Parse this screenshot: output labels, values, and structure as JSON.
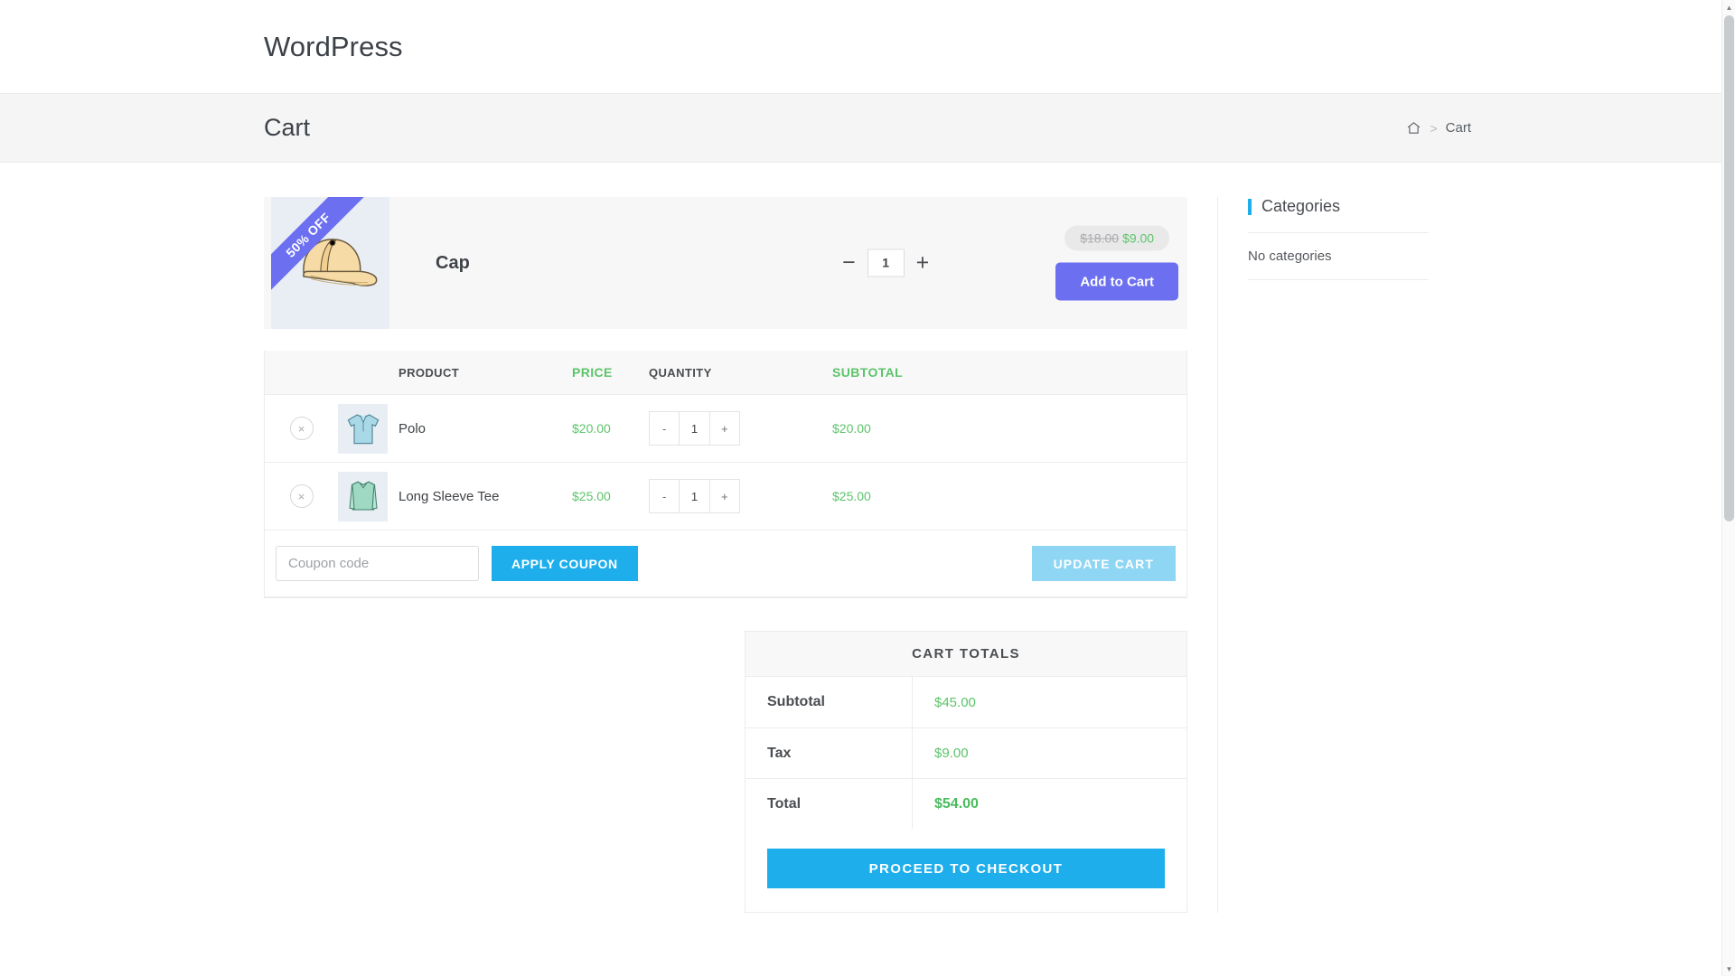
{
  "site": {
    "title": "WordPress"
  },
  "page": {
    "title": "Cart",
    "breadcrumb": {
      "home_icon": "home-icon",
      "separator": ">",
      "current": "Cart"
    }
  },
  "featured_product": {
    "name": "Cap",
    "badge": "50% OFF",
    "thumb_alt": "cap-product-image",
    "quantity": "1",
    "decrement": "−",
    "increment": "+",
    "price_old": "$18.00",
    "price_new": "$9.00",
    "add_to_cart_label": "Add to Cart",
    "accent_color": "#6c6ff0"
  },
  "cart_table": {
    "columns": [
      "",
      "",
      "PRODUCT",
      "PRICE",
      "QUANTITY",
      "SUBTOTAL"
    ],
    "headers": {
      "product": "PRODUCT",
      "price": "PRICE",
      "quantity": "QUANTITY",
      "subtotal": "SUBTOTAL"
    },
    "rows": [
      {
        "remove_label": "×",
        "thumb_alt": "polo-product-image",
        "name": "Polo",
        "price": "$20.00",
        "qty_minus": "-",
        "qty": "1",
        "qty_plus": "+",
        "subtotal": "$20.00"
      },
      {
        "remove_label": "×",
        "thumb_alt": "long-sleeve-tee-product-image",
        "name": "Long Sleeve Tee",
        "price": "$25.00",
        "qty_minus": "-",
        "qty": "1",
        "qty_plus": "+",
        "subtotal": "$25.00"
      }
    ],
    "coupon": {
      "placeholder": "Coupon code",
      "value": "",
      "apply_label": "APPLY COUPON",
      "update_label": "UPDATE CART"
    }
  },
  "cart_totals": {
    "heading": "CART TOTALS",
    "rows": [
      {
        "label": "Subtotal",
        "value": "$45.00"
      },
      {
        "label": "Tax",
        "value": "$9.00"
      },
      {
        "label": "Total",
        "value": "$54.00"
      }
    ],
    "checkout_label": "PROCEED TO CHECKOUT"
  },
  "sidebar": {
    "widget_title": "Categories",
    "items": [
      "No categories"
    ]
  },
  "colors": {
    "accent_cyan": "#1eaeec",
    "accent_purple": "#6c6ff0",
    "price_green": "#5cc46a"
  }
}
